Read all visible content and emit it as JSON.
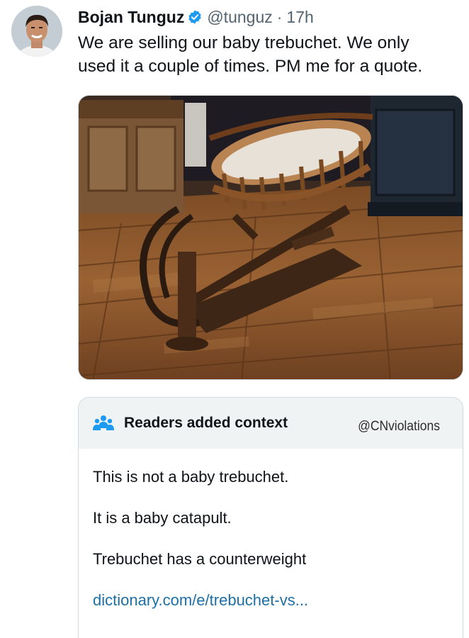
{
  "author": {
    "name": "Bojan Tunguz",
    "handle": "@tunguz",
    "separator": "·",
    "time": "17h",
    "verified": true,
    "avatar_icon": "profile-photo"
  },
  "tweet": {
    "lines": [
      "We are selling our baby trebuchet. We only",
      "used it a couple of times. PM me for a quote."
    ]
  },
  "media": {
    "icon": "photo-wooden-cradle-on-rocker"
  },
  "community_note": {
    "icon": "people-icon",
    "title": "Readers added context",
    "credit": "@CNviolations",
    "lines": [
      "This is not a baby trebuchet.",
      "It is a baby catapult.",
      "Trebuchet has a counterweight"
    ],
    "link": "dictionary.com/e/trebuchet-vs..."
  },
  "colors": {
    "verified_badge": "#1d9bf0",
    "link": "#1d6fa5",
    "secondary_text": "#536471",
    "note_header_bg": "#eff3f4"
  }
}
